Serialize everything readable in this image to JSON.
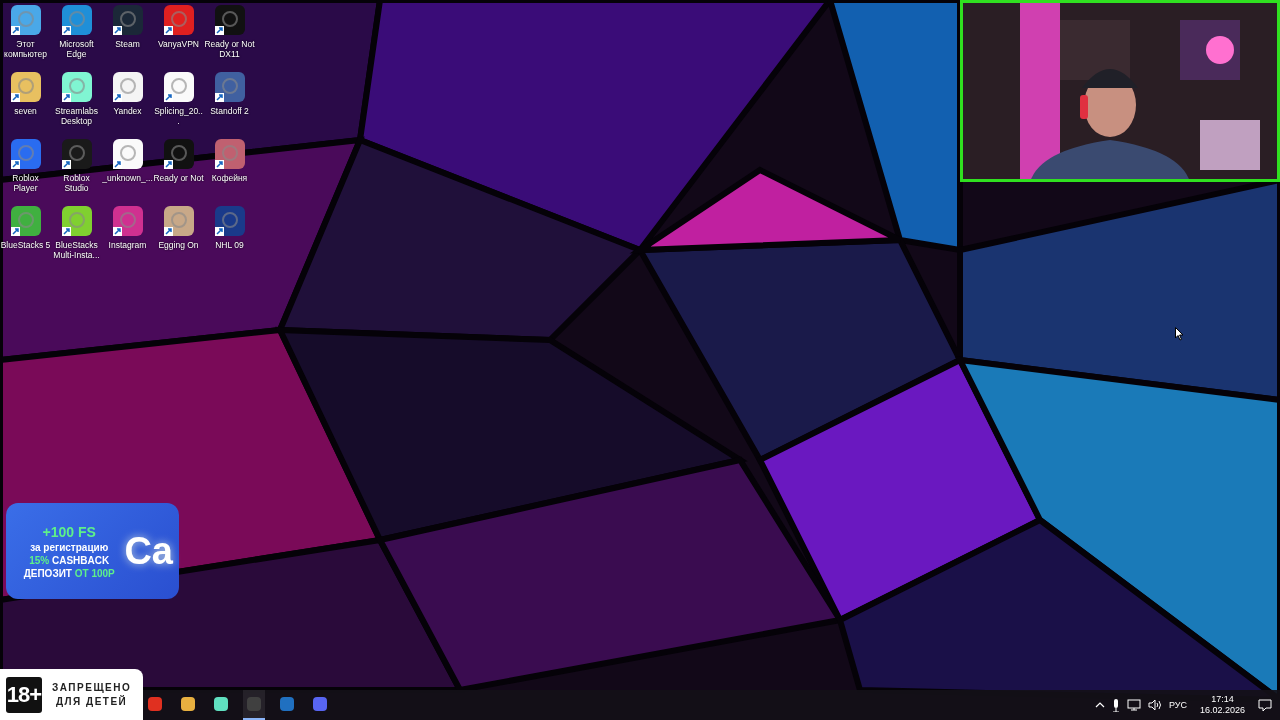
{
  "desktop_icons": [
    {
      "label": "Этот компьютер",
      "color": "#4aa8e8"
    },
    {
      "label": "Microsoft Edge",
      "color": "#1f8fd8"
    },
    {
      "label": "Steam",
      "color": "#1b2838"
    },
    {
      "label": "VanyaVPN",
      "color": "#e02020"
    },
    {
      "label": "Ready or Not DX11",
      "color": "#111111"
    },
    {
      "label": "seven",
      "color": "#e8c060"
    },
    {
      "label": "Streamlabs Desktop",
      "color": "#80f5d2"
    },
    {
      "label": "Yandex",
      "color": "#f4f4f4"
    },
    {
      "label": "Splicing_20...",
      "color": "#fafafa"
    },
    {
      "label": "Standoff 2",
      "color": "#4060a0"
    },
    {
      "label": "Roblox Player",
      "color": "#2a6cf0"
    },
    {
      "label": "Roblox Studio",
      "color": "#1a1a1a"
    },
    {
      "label": "_unknown_...",
      "color": "#fafafa"
    },
    {
      "label": "Ready or Not",
      "color": "#111111"
    },
    {
      "label": "Кофейня",
      "color": "#c06070"
    },
    {
      "label": "BlueStacks 5",
      "color": "#40b040"
    },
    {
      "label": "BlueStacks Multi-Insta...",
      "color": "#80d030"
    },
    {
      "label": "Instagram",
      "color": "#d03090"
    },
    {
      "label": "Egging On",
      "color": "#c8a888"
    },
    {
      "label": "NHL 09",
      "color": "#1a3a8a"
    }
  ],
  "promo_banner": {
    "logo": "Ca",
    "lines": [
      [
        {
          "text": "+100 FS",
          "accent": true
        }
      ],
      [
        {
          "text": "за регистрацию",
          "accent": false
        }
      ],
      [
        {
          "text": "15%",
          "accent": true
        },
        {
          "text": " CASHBACK",
          "accent": false
        }
      ],
      [
        {
          "text": "ДЕПОЗИТ ",
          "accent": false
        },
        {
          "text": "ОТ 100Р",
          "accent": true
        }
      ]
    ]
  },
  "age_banner": {
    "badge": "18+",
    "lines": [
      "ЗАПРЕЩЕНО",
      "ДЛЯ ДЕТЕЙ"
    ]
  },
  "taskbar": {
    "apps": [
      {
        "color": "#e03020",
        "selected": false
      },
      {
        "color": "#e8b040",
        "selected": false
      },
      {
        "color": "#60e0c0",
        "selected": false
      },
      {
        "color": "#404040",
        "selected": true
      },
      {
        "color": "#2070c0",
        "selected": false
      },
      {
        "color": "#5865f2",
        "selected": false
      }
    ],
    "language": "РУС",
    "time": "17:14",
    "date": "16.02.2026"
  }
}
